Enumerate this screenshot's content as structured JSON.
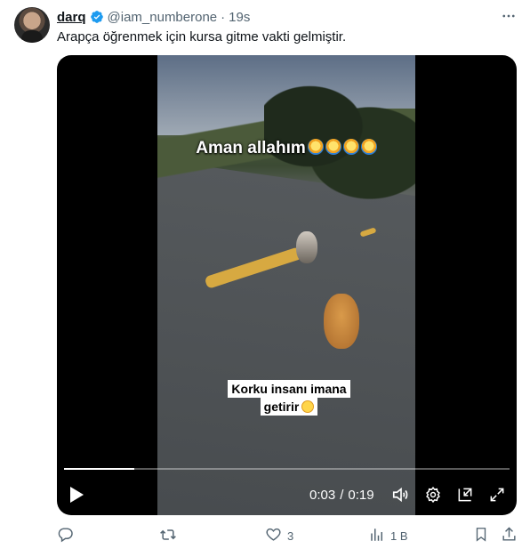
{
  "author": {
    "name": "darq",
    "handle": "@iam_numberone",
    "separator": "·",
    "time": "19s"
  },
  "tweet": {
    "text": "Arapça öğrenmek için kursa gitme vakti gelmiştir."
  },
  "video": {
    "caption_top": "Aman allahım",
    "caption_bottom_line1": "Korku insanı imana",
    "caption_bottom_line2": "getirir",
    "current_time": "0:03",
    "time_separator": "/",
    "duration": "0:19",
    "progress_fraction": 0.1579
  },
  "icons": {
    "verified": "verified-badge-icon",
    "more": "more-icon",
    "play": "play-icon",
    "volume": "volume-icon",
    "settings": "settings-icon",
    "pip": "picture-in-picture-icon",
    "fullscreen": "fullscreen-icon",
    "reply": "reply-icon",
    "retweet": "retweet-icon",
    "like": "like-icon",
    "views": "views-icon",
    "bookmark": "bookmark-icon",
    "share": "share-icon"
  },
  "actions": {
    "reply_count": "",
    "retweet_count": "",
    "like_count": "3",
    "views_count": "1 B"
  },
  "colors": {
    "verified": "#1d9bf0",
    "secondary_text": "#536471",
    "primary_text": "#0f1419"
  }
}
